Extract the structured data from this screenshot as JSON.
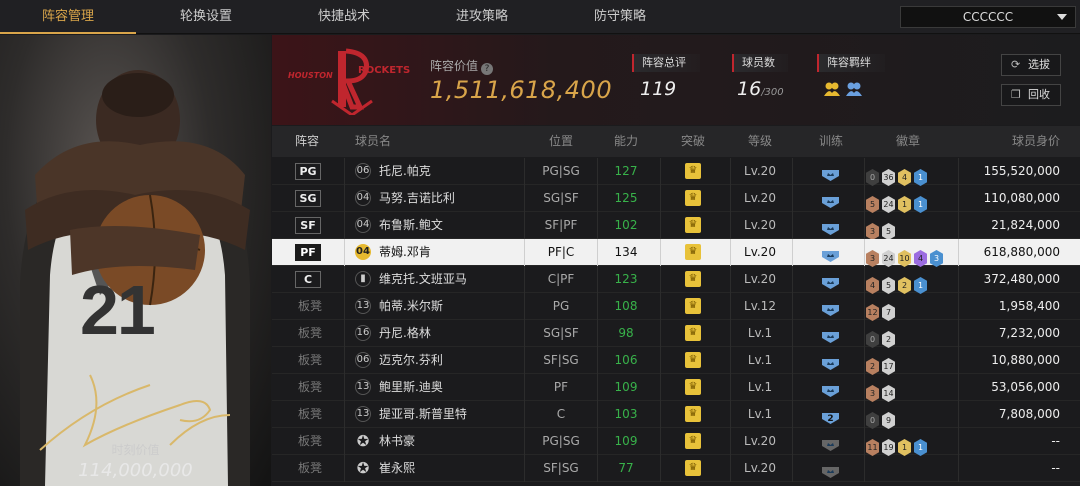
{
  "tabs": [
    {
      "label": "阵容管理",
      "active": true
    },
    {
      "label": "轮换设置"
    },
    {
      "label": "快捷战术"
    },
    {
      "label": "进攻策略"
    },
    {
      "label": "防守策略"
    }
  ],
  "dropdown": {
    "value": "CCCCCC"
  },
  "card": {
    "jersey": "21",
    "value_label": "时刻价值",
    "value": "114,000,000"
  },
  "header": {
    "team_logo_text": [
      "HOUSTON",
      "ROCKETS"
    ],
    "lineup_value_label": "阵容价值",
    "lineup_value": "1,511,618,400",
    "overall_label": "阵容总评",
    "overall": "119",
    "player_count_label": "球员数",
    "player_count": "16",
    "player_count_max": "/300",
    "bond_label": "阵容羁绊",
    "buttons": {
      "select": "选拔",
      "recycle": "回收"
    }
  },
  "table": {
    "headers": {
      "lineup": "阵容",
      "name": "球员名",
      "pos": "位置",
      "ability": "能力",
      "breakthrough": "突破",
      "level": "等级",
      "training": "训练",
      "badges": "徽章",
      "value": "球员身价"
    },
    "rows": [
      {
        "lineup": "PG",
        "starter": true,
        "jersey": "06",
        "name": "托尼.帕克",
        "pos": "PG|SG",
        "ability": "127",
        "level": "Lv.20",
        "training": "crest",
        "badges": [
          [
            "0",
            "b0"
          ],
          [
            "36",
            "b2"
          ],
          [
            "4",
            "b3"
          ],
          [
            "1",
            "b5"
          ]
        ],
        "value": "155,520,000"
      },
      {
        "lineup": "SG",
        "starter": true,
        "jersey": "04",
        "name": "马努.吉诺比利",
        "pos": "SG|SF",
        "ability": "125",
        "level": "Lv.20",
        "training": "crest",
        "badges": [
          [
            "5",
            "b1"
          ],
          [
            "24",
            "b2"
          ],
          [
            "1",
            "b3"
          ],
          [
            "1",
            "b5"
          ]
        ],
        "value": "110,080,000"
      },
      {
        "lineup": "SF",
        "starter": true,
        "jersey": "04",
        "name": "布鲁斯.鲍文",
        "pos": "SF|PF",
        "ability": "102",
        "level": "Lv.20",
        "training": "crest",
        "badges": [
          [
            "3",
            "b1"
          ],
          [
            "5",
            "b2"
          ]
        ],
        "value": "21,824,000"
      },
      {
        "lineup": "PF",
        "starter": true,
        "selected": true,
        "jersey": "04",
        "jersey_style": "gold",
        "name": "蒂姆.邓肯",
        "pos": "PF|C",
        "ability": "134",
        "level": "Lv.20",
        "training": "crest",
        "badges": [
          [
            "3",
            "b1"
          ],
          [
            "24",
            "b2"
          ],
          [
            "10",
            "b3"
          ],
          [
            "4",
            "b4"
          ],
          [
            "3",
            "b5"
          ]
        ],
        "value": "618,880,000"
      },
      {
        "lineup": "C",
        "starter": true,
        "jersey": "bars",
        "name": "维克托.文班亚马",
        "pos": "C|PF",
        "ability": "123",
        "level": "Lv.20",
        "training": "crest",
        "badges": [
          [
            "4",
            "b1"
          ],
          [
            "5",
            "b2"
          ],
          [
            "2",
            "b3"
          ],
          [
            "1",
            "b5"
          ]
        ],
        "value": "372,480,000"
      },
      {
        "lineup": "板凳",
        "jersey": "13",
        "name": "帕蒂.米尔斯",
        "pos": "PG",
        "ability": "108",
        "level": "Lv.12",
        "training": "crest",
        "badges": [
          [
            "12",
            "b1"
          ],
          [
            "7",
            "b2"
          ]
        ],
        "value": "1,958,400"
      },
      {
        "lineup": "板凳",
        "jersey": "16",
        "name": "丹尼.格林",
        "pos": "SG|SF",
        "ability": "98",
        "level": "Lv.1",
        "training": "crest",
        "badges": [
          [
            "0",
            "b0"
          ],
          [
            "2",
            "b2"
          ]
        ],
        "value": "7,232,000"
      },
      {
        "lineup": "板凳",
        "jersey": "06",
        "name": "迈克尔.芬利",
        "pos": "SF|SG",
        "ability": "106",
        "level": "Lv.1",
        "training": "crest",
        "badges": [
          [
            "2",
            "b1"
          ],
          [
            "17",
            "b2"
          ]
        ],
        "value": "10,880,000"
      },
      {
        "lineup": "板凳",
        "jersey": "13",
        "name": "鲍里斯.迪奥",
        "pos": "PF",
        "ability": "109",
        "level": "Lv.1",
        "training": "crest",
        "badges": [
          [
            "3",
            "b1"
          ],
          [
            "14",
            "b2"
          ]
        ],
        "value": "53,056,000"
      },
      {
        "lineup": "板凳",
        "jersey": "13",
        "name": "提亚哥.斯普里特",
        "pos": "C",
        "ability": "103",
        "level": "Lv.1",
        "training": "number",
        "training_text": "2",
        "badges": [
          [
            "0",
            "b0"
          ],
          [
            "9",
            "b2"
          ]
        ],
        "value": "7,808,000"
      },
      {
        "lineup": "板凳",
        "jersey": "star",
        "name": "林书豪",
        "pos": "PG|SG",
        "ability": "109",
        "level": "Lv.20",
        "training": "grey",
        "badges": [
          [
            "11",
            "b1"
          ],
          [
            "19",
            "b2"
          ],
          [
            "1",
            "b3"
          ],
          [
            "1",
            "b5"
          ]
        ],
        "value": "--"
      },
      {
        "lineup": "板凳",
        "jersey": "star",
        "name": "崔永熙",
        "pos": "SF|SG",
        "ability": "77",
        "level": "Lv.20",
        "training": "grey",
        "badges": [],
        "value": "--"
      }
    ]
  },
  "colors": {
    "accent": "#d9a54a",
    "ability": "#38b24a",
    "rockets_red": "#c0262e",
    "selected_row": "#f1f1f1"
  }
}
